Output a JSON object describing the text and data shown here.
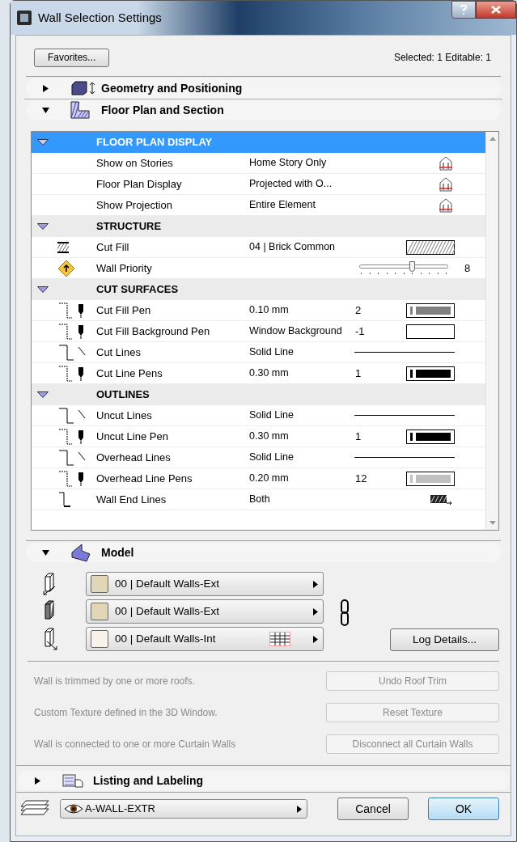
{
  "window": {
    "title": "Wall Selection Settings"
  },
  "favorites_button": "Favorites...",
  "selection_info": "Selected: 1 Editable: 1",
  "sections": [
    {
      "kind": "geometry",
      "title": "Geometry and Positioning",
      "expanded": false
    },
    {
      "kind": "floorplan",
      "title": "Floor Plan and Section",
      "expanded": true
    }
  ],
  "table": {
    "rows": [
      {
        "kind": "group",
        "label": "FLOOR PLAN DISPLAY",
        "expanded": true,
        "selected": true
      },
      {
        "kind": "story",
        "label": "Show on Stories",
        "value": "Home Story Only",
        "selected": false
      },
      {
        "kind": "story",
        "label": "Floor Plan Display",
        "value": "Projected with O...",
        "selected": false
      },
      {
        "kind": "story",
        "label": "Show Projection",
        "value": "Entire Element",
        "selected": false
      },
      {
        "kind": "group",
        "label": "STRUCTURE",
        "expanded": true,
        "selected": false
      },
      {
        "kind": "fill",
        "label": "Cut Fill",
        "value": "04 | Brick Common",
        "selected": false
      },
      {
        "kind": "slider",
        "label": "Wall Priority",
        "level": 0.6,
        "reading": "8",
        "selected": false
      },
      {
        "kind": "group",
        "label": "CUT SURFACES",
        "expanded": true,
        "selected": false
      },
      {
        "kind": "pen",
        "label": "Cut Fill Pen",
        "value": "0.10 mm",
        "number": "2",
        "color": "#808080",
        "selected": false
      },
      {
        "kind": "pen",
        "label": "Cut Fill Background Pen",
        "value": "Window Background",
        "number": "-1",
        "color": "#ffffff",
        "selected": false
      },
      {
        "kind": "line",
        "label": "Cut Lines",
        "value": "Solid Line",
        "selected": false
      },
      {
        "kind": "pen",
        "label": "Cut Line Pens",
        "value": "0.30 mm",
        "number": "1",
        "color": "#000000",
        "selected": false
      },
      {
        "kind": "group",
        "label": "OUTLINES",
        "expanded": true,
        "selected": false
      },
      {
        "kind": "line",
        "label": "Uncut Lines",
        "value": "Solid Line",
        "selected": false
      },
      {
        "kind": "pen",
        "label": "Uncut Line Pen",
        "value": "0.30 mm",
        "number": "1",
        "color": "#000000",
        "selected": false
      },
      {
        "kind": "line",
        "label": "Overhead Lines",
        "value": "Solid Line",
        "selected": false
      },
      {
        "kind": "pen",
        "label": "Overhead Line Pens",
        "value": "0.20 mm",
        "number": "12",
        "color": "#c0c0c0",
        "selected": false
      },
      {
        "kind": "end",
        "label": "Wall End Lines",
        "value": "Both",
        "selected": false
      }
    ]
  },
  "model": {
    "title": "Model",
    "expanded": true,
    "surfaces": [
      {
        "label": "00 | Default Walls-Ext",
        "color": "#e2d6b8",
        "pattern": false
      },
      {
        "label": "00 | Default Walls-Ext",
        "color": "#e2d6b8",
        "pattern": false
      },
      {
        "label": "00 | Default Walls-Int",
        "color": "#f7f3ea",
        "pattern": true
      }
    ],
    "log_button": "Log Details...",
    "messages": [
      {
        "text": "Wall is trimmed by one or more roofs.",
        "button": "Undo Roof Trim",
        "disabled": true
      },
      {
        "text": "Custom Texture defined in the 3D Window.",
        "button": "Reset Texture",
        "disabled": true
      },
      {
        "text": "Wall is connected to one or more Curtain Walls",
        "button": "Disconnect all Curtain Walls",
        "disabled": true
      }
    ]
  },
  "listing": {
    "title": "Listing and Labeling",
    "expanded": false
  },
  "layer": {
    "value": "A-WALL-EXTR",
    "visible": true
  },
  "buttons": [
    {
      "label": "Cancel",
      "default": false
    },
    {
      "label": "OK",
      "default": true
    }
  ]
}
